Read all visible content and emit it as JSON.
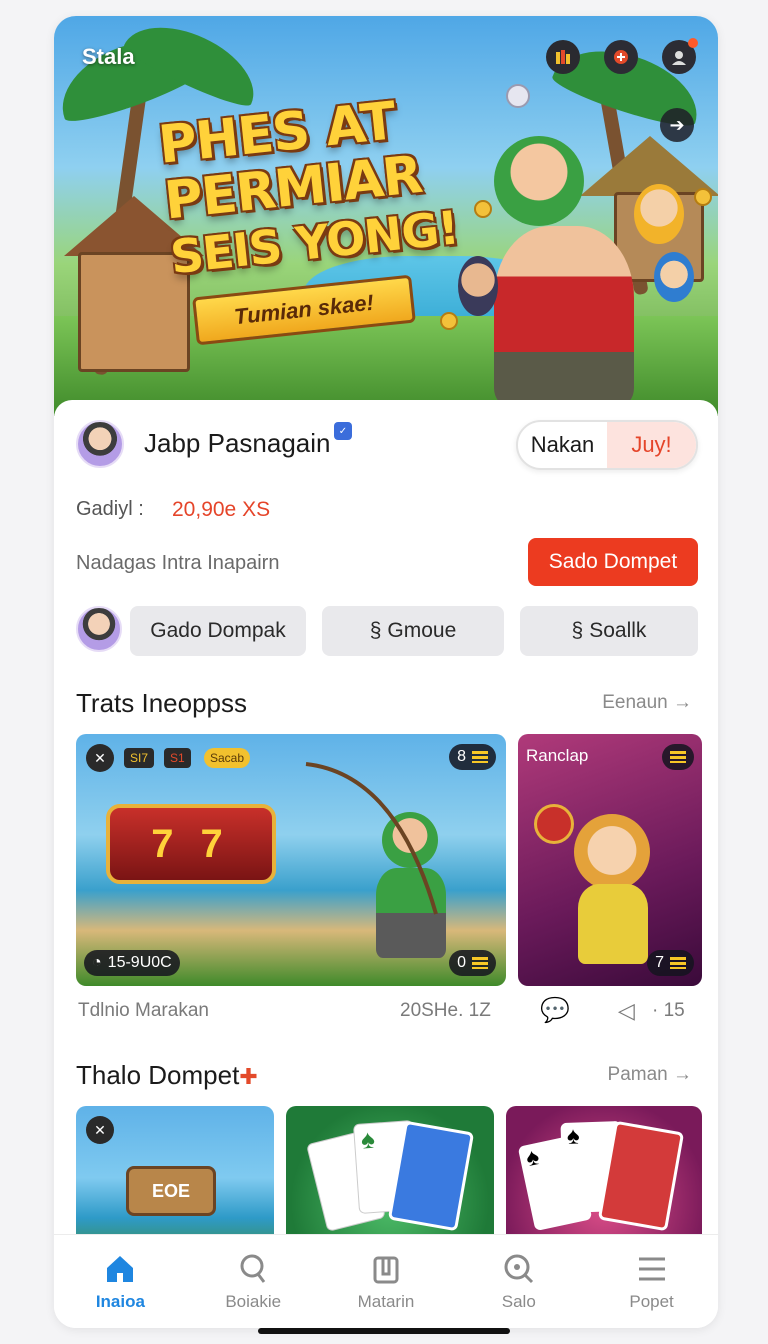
{
  "hero": {
    "brand": "Stala",
    "title_lines": [
      "PHES AT",
      "PERMIAR",
      "SEIS YONG!"
    ],
    "banner_text": "Tumian skae!",
    "icons": [
      "chart-icon",
      "game-icon",
      "profile-icon"
    ]
  },
  "profile": {
    "name": "Jabp Pasnagain",
    "toggle": {
      "left": "Nakan",
      "right": "Juy!"
    },
    "balance_label": "Gadiyl :",
    "balance_value": "20,90e XS",
    "subtitle": "Nadagas Intra Inapairn",
    "primary_button": "Sado Dompet",
    "chips": [
      "Gado Dompak",
      "Gmoue",
      "Soallk"
    ],
    "chip_icon": "§"
  },
  "section1": {
    "title": "Trats Ineoppss",
    "more": "Eenaun",
    "tile1": {
      "tag1": "SI7",
      "tag2": "S1",
      "tag3": "Sacab",
      "slot": "7 7",
      "counter": "8",
      "bottom_left": "15-9U0C",
      "bottom_right": "0"
    },
    "tile2": {
      "label": "Ranclap",
      "counter": "7"
    },
    "meta_left": "Tdlnio Marakan",
    "meta_mid": "20SHe. 1Z",
    "meta_right": "· 15"
  },
  "section2": {
    "title": "Thalo Dompet",
    "more": "Paman",
    "tile_label": "EOE"
  },
  "nav": {
    "items": [
      {
        "label": "Inaioa",
        "icon": "home-icon"
      },
      {
        "label": "Boiakie",
        "icon": "search-bubble-icon"
      },
      {
        "label": "Matarin",
        "icon": "cards-icon"
      },
      {
        "label": "Salo",
        "icon": "search-icon"
      },
      {
        "label": "Popet",
        "icon": "menu-icon"
      }
    ]
  },
  "colors": {
    "accent": "#ec3b20",
    "nav_active": "#1f86e0",
    "hero_title": "#ffd23a"
  }
}
